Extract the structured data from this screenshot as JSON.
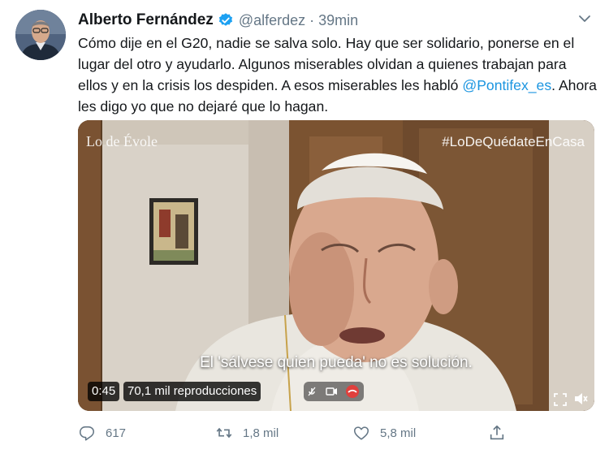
{
  "tweet": {
    "author_name": "Alberto Fernández",
    "handle": "@alferdez",
    "separator": "·",
    "time": "39min",
    "text_before_mention": "Cómo dije en el G20, nadie se salva solo. Hay que ser solidario, ponerse en el lugar del otro y ayudarlo. Algunos miserables olvidan a quienes trabajan para ellos y en la crisis los despiden. A esos miserables les habló ",
    "mention": "@Pontifex_es",
    "text_after_mention": ". Ahora les digo yo que no dejaré que lo hagan."
  },
  "video": {
    "watermark_left": "Lo de Évole",
    "watermark_right": "#LoDeQuédateEnCasa",
    "subtitle": "El 'sálvese quien pueda' no es solución.",
    "duration": "0:45",
    "views": "70,1 mil reproducciones"
  },
  "actions": {
    "replies": "617",
    "retweets": "1,8 mil",
    "likes": "5,8 mil"
  },
  "colors": {
    "text": "#14171a",
    "secondary": "#657786",
    "link": "#1b95e0",
    "verified": "#1da1f2"
  },
  "icons": [
    "verified-badge-icon",
    "caret-down-icon",
    "reply-icon",
    "retweet-icon",
    "like-icon",
    "share-icon",
    "fullscreen-icon",
    "volume-icon",
    "video-call-controls-icon"
  ]
}
